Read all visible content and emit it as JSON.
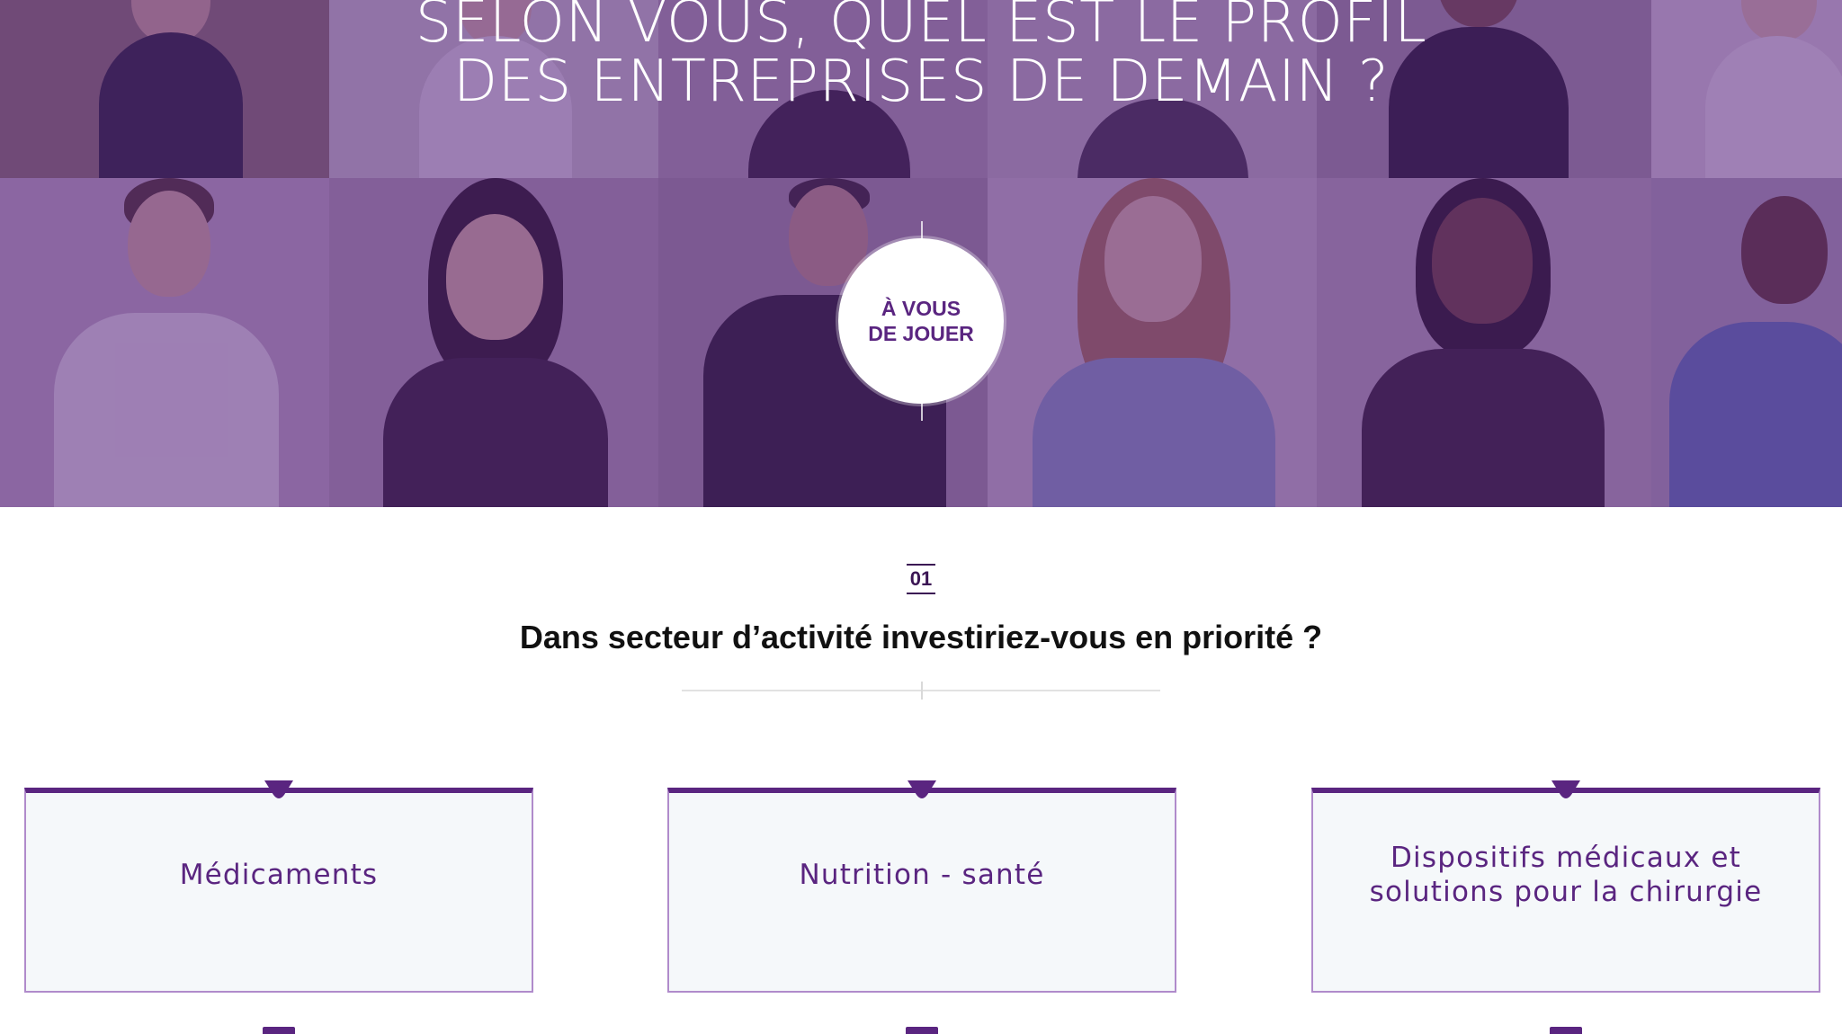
{
  "hero": {
    "title_line1": "SELON VOUS, QUEL EST LE PROFIL",
    "title_line2": "DES ENTREPRISES DE DEMAIN ?",
    "cta_line1": "À VOUS",
    "cta_line2": "DE JOUER"
  },
  "question": {
    "number": "01",
    "text": "Dans secteur d’activité investiriez-vous en priorité ?"
  },
  "options": [
    {
      "label": "Médicaments"
    },
    {
      "label": "Nutrition - santé"
    },
    {
      "label": "Dispositifs médicaux et solutions pour la chirurgie"
    }
  ],
  "colors": {
    "brand_purple": "#5a2580",
    "hero_overlay": "#582280",
    "card_background": "#f5f8fa",
    "card_border": "#b08bcb"
  }
}
